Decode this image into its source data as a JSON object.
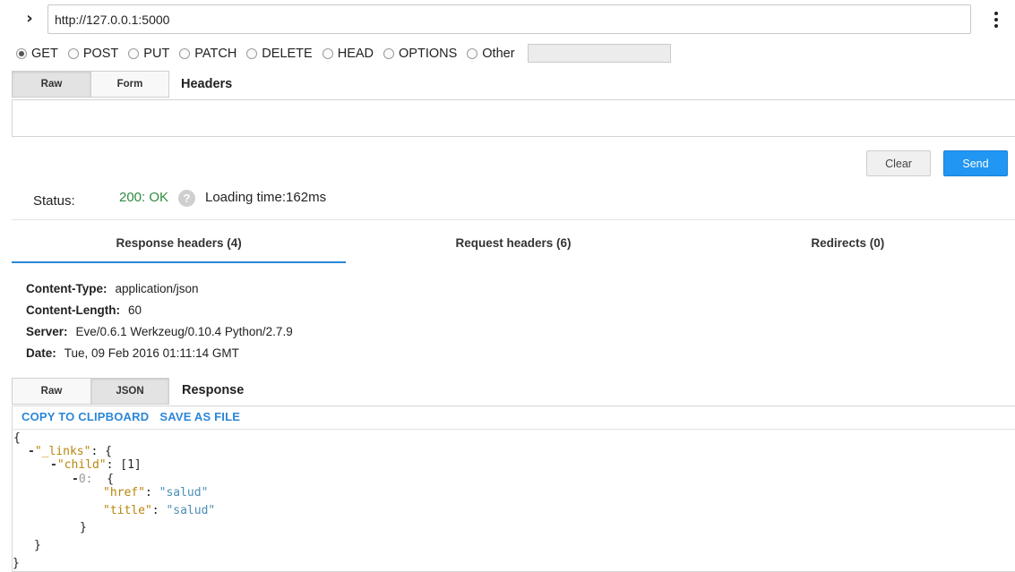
{
  "url_bar": {
    "url": "http://127.0.0.1:5000",
    "toggle_icon": "chevron-right-icon",
    "menu_icon": "vertical-dots-icon"
  },
  "methods": {
    "options": [
      "GET",
      "POST",
      "PUT",
      "PATCH",
      "DELETE",
      "HEAD",
      "OPTIONS",
      "Other"
    ],
    "selected": "GET",
    "other_value": ""
  },
  "headers_editor": {
    "tabs": [
      "Raw",
      "Form"
    ],
    "active_tab": "Raw",
    "label": "Headers",
    "value": ""
  },
  "actions": {
    "clear_label": "Clear",
    "send_label": "Send",
    "send_color": "#2196f3"
  },
  "status": {
    "label": "Status:",
    "value": "200: OK",
    "value_color": "#2e8b3e",
    "help_icon": "question-circle-icon",
    "loading_time": "Loading time:162ms"
  },
  "response_tabs": {
    "tabs": [
      "Response headers (4)",
      "Request headers (6)",
      "Redirects (0)"
    ],
    "active": "Response headers (4)",
    "accent": "#2b86d8"
  },
  "response_headers": [
    {
      "name": "Content-Type:",
      "value": "application/json"
    },
    {
      "name": "Content-Length:",
      "value": "60"
    },
    {
      "name": "Server:",
      "value": "Eve/0.6.1 Werkzeug/0.10.4 Python/2.7.9"
    },
    {
      "name": "Date:",
      "value": "Tue, 09 Feb 2016 01:11:14 GMT"
    }
  ],
  "response": {
    "tabs": [
      "Raw",
      "JSON"
    ],
    "active_tab": "JSON",
    "label": "Response",
    "copy_label": "COPY TO CLIPBOARD",
    "save_label": "SAVE AS FILE",
    "json": {
      "open_brace": "{",
      "links_key": "\"_links\"",
      "child_key": "\"child\"",
      "child_count": "[1]",
      "index": "0:",
      "href_key": "\"href\"",
      "href_value": "\"salud\"",
      "title_key": "\"title\"",
      "title_value": "\"salud\"",
      "close_brace": "}",
      "colon": ":",
      "inner_open": "{",
      "collapse_marker": "-"
    }
  }
}
